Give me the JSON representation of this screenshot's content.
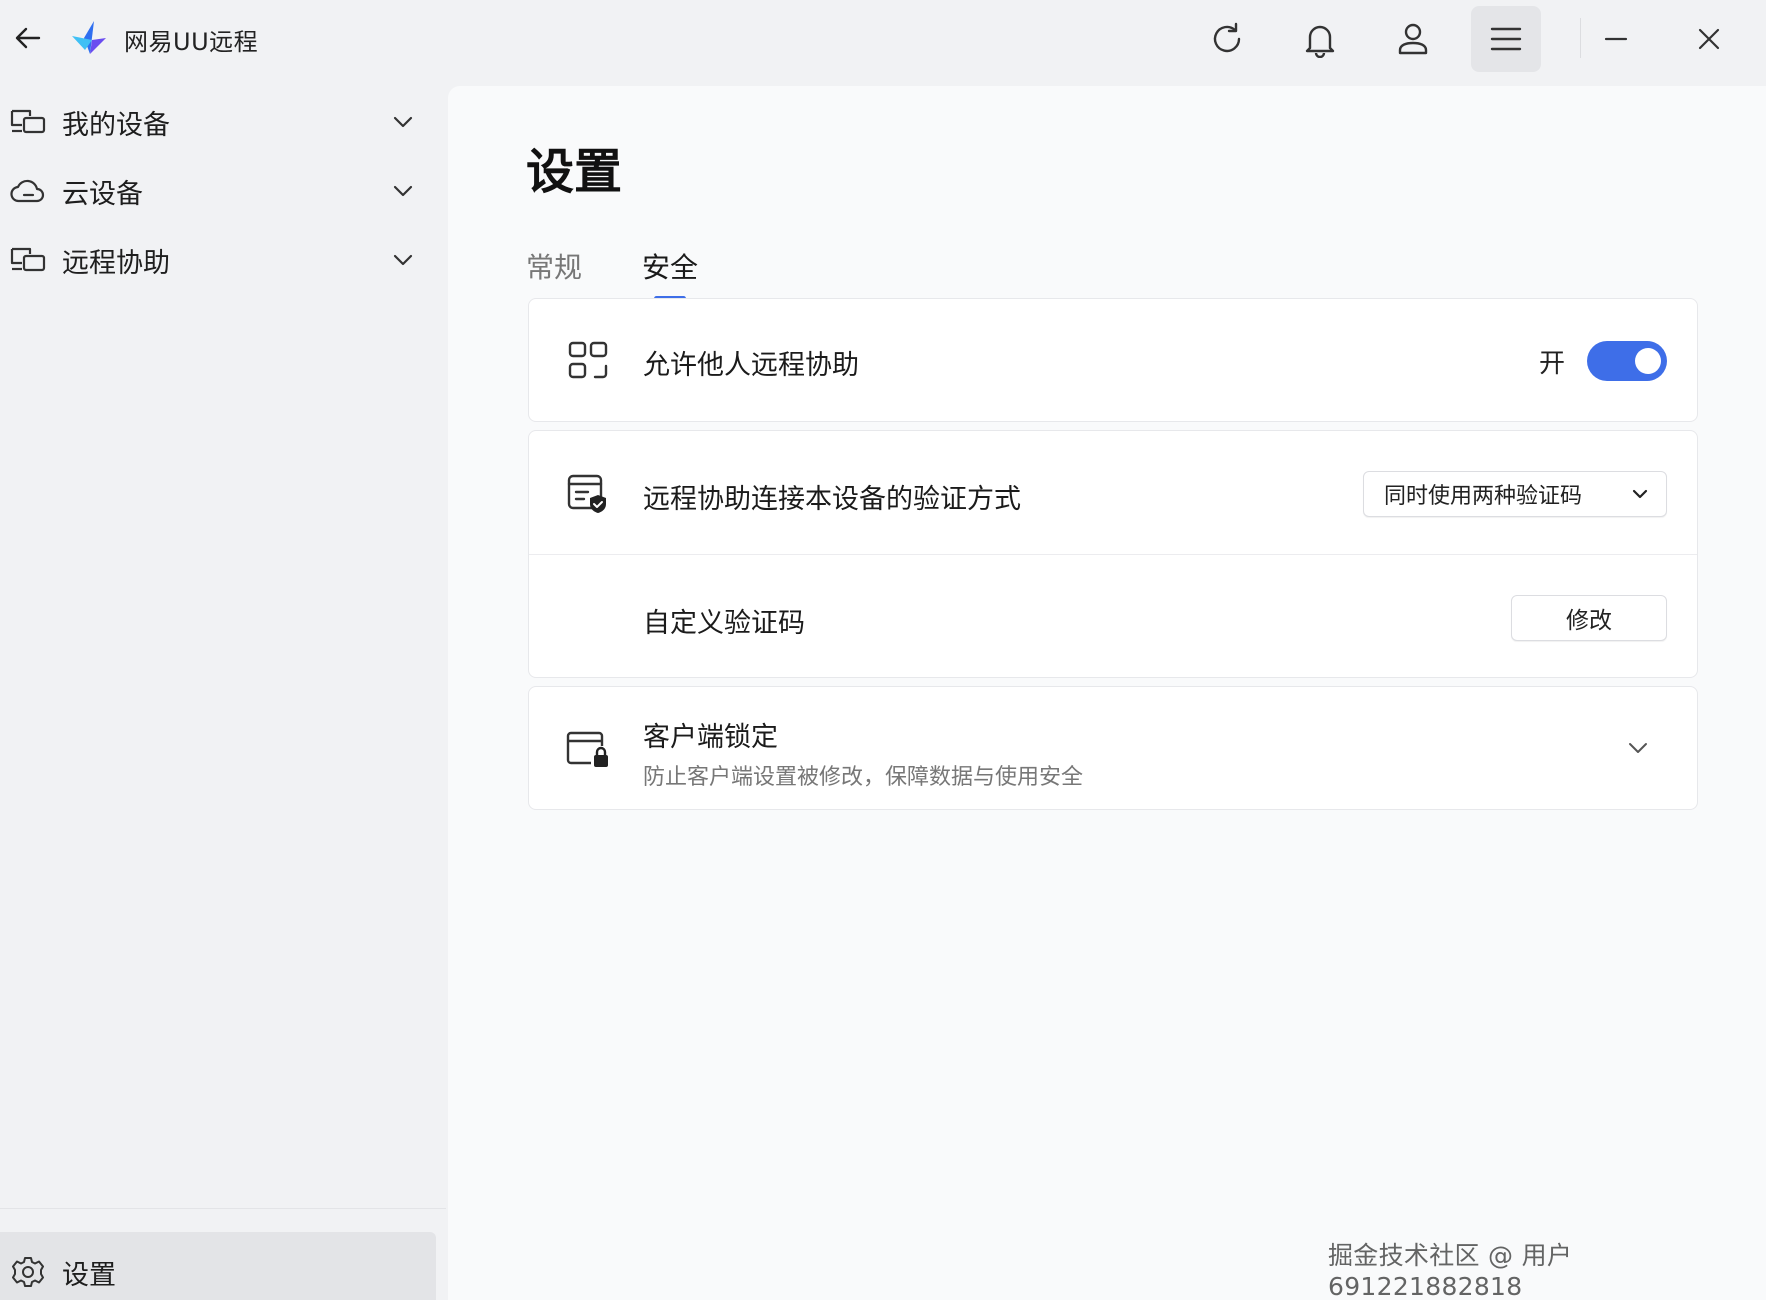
{
  "app": {
    "title": "网易UU远程"
  },
  "titlebar": {
    "buttons": [
      "refresh-icon",
      "bell-icon",
      "user-icon",
      "menu-icon",
      "minimize-icon",
      "close-icon"
    ]
  },
  "sidebar": {
    "items": [
      {
        "label": "我的设备",
        "icon": "devices-icon"
      },
      {
        "label": "云设备",
        "icon": "cloud-icon"
      },
      {
        "label": "远程协助",
        "icon": "remote-assist-icon"
      }
    ],
    "settings_label": "设置"
  },
  "main": {
    "title": "设置",
    "tabs": [
      {
        "label": "常规",
        "active": false
      },
      {
        "label": "安全",
        "active": true
      }
    ],
    "allow_remote": {
      "label": "允许他人远程协助",
      "state_label": "开",
      "enabled": true
    },
    "verification": {
      "label": "远程协助连接本设备的验证方式",
      "selected": "同时使用两种验证码"
    },
    "custom_code": {
      "label": "自定义验证码",
      "button": "修改"
    },
    "client_lock": {
      "label": "客户端锁定",
      "description": "防止客户端设置被修改，保障数据与使用安全"
    }
  },
  "watermark": "掘金技术社区 @ 用户691221882818",
  "colors": {
    "accent": "#3e6ee8",
    "background": "#f1f2f4",
    "content": "#f9fafb"
  }
}
